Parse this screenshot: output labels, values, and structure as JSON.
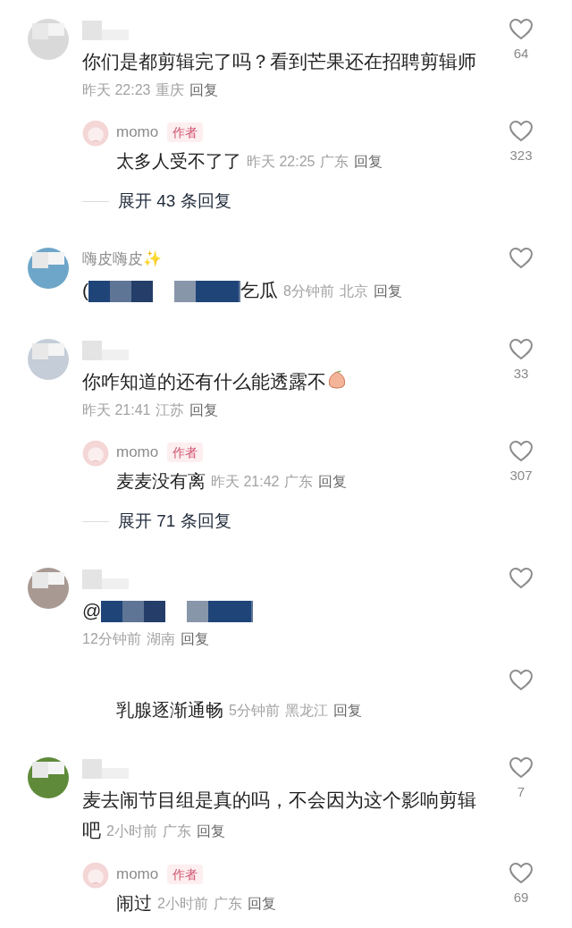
{
  "comments": [
    {
      "author": {
        "hidden": true
      },
      "avatar": {
        "kind": "user",
        "color": "#d9d9d9"
      },
      "content": [
        {
          "kind": "text",
          "text": "你们是都剪辑完了吗？看到芒果还在招聘剪辑师"
        }
      ],
      "meta_on_own_line": true,
      "time": "昨天 22:23",
      "location": "重庆",
      "reply_label": "回复",
      "likes": "64",
      "replies": [
        {
          "author": {
            "name": "momo",
            "badge": "作者"
          },
          "avatar": {
            "kind": "author",
            "color": "#f4d6d6"
          },
          "content": [
            {
              "kind": "text",
              "text": "太多人受不了了"
            }
          ],
          "time": "昨天 22:25",
          "location": "广东",
          "reply_label": "回复",
          "likes": "323"
        }
      ],
      "expand": "展开 43 条回复"
    },
    {
      "author": {
        "name": "嗨皮嗨皮✨"
      },
      "avatar": {
        "kind": "user",
        "color": "#6ea6c9"
      },
      "content": [
        {
          "kind": "text",
          "text": "("
        },
        {
          "kind": "redacted"
        },
        {
          "kind": "text",
          "text": "乞瓜"
        }
      ],
      "meta_on_own_line": false,
      "time": "8分钟前",
      "location": "北京",
      "reply_label": "回复"
    },
    {
      "author": {
        "hidden": true
      },
      "avatar": {
        "kind": "user",
        "color": "#c4cdd8"
      },
      "content": [
        {
          "kind": "text",
          "text": "你咋知道的还有什么能透露不"
        },
        {
          "kind": "emoji"
        }
      ],
      "meta_on_own_line": true,
      "time": "昨天 21:41",
      "location": "江苏",
      "reply_label": "回复",
      "likes": "33",
      "replies": [
        {
          "author": {
            "name": "momo",
            "badge": "作者"
          },
          "avatar": {
            "kind": "author",
            "color": "#f4d6d6"
          },
          "content": [
            {
              "kind": "text",
              "text": "麦麦没有离"
            }
          ],
          "time": "昨天 21:42",
          "location": "广东",
          "reply_label": "回复",
          "likes": "307"
        }
      ],
      "expand": "展开 71 条回复"
    },
    {
      "author": {
        "hidden": true
      },
      "avatar": {
        "kind": "user",
        "color": "#a89a92"
      },
      "content": [
        {
          "kind": "text",
          "text": "@"
        },
        {
          "kind": "redacted"
        }
      ],
      "meta_on_own_line": true,
      "time": "12分钟前",
      "location": "湖南",
      "reply_label": "回复",
      "replies": [
        {
          "content": [
            {
              "kind": "text",
              "text": "乳腺逐渐通畅"
            }
          ],
          "time": "5分钟前",
          "location": "黑龙江",
          "reply_label": "回复"
        }
      ]
    },
    {
      "author": {
        "hidden": true
      },
      "avatar": {
        "kind": "user",
        "color": "#5f8a3a"
      },
      "content": [
        {
          "kind": "text",
          "text": "麦去闹节目组是真的吗，不会因为这个影响剪辑吧"
        }
      ],
      "meta_on_own_line": false,
      "time": "2小时前",
      "location": "广东",
      "reply_label": "回复",
      "likes": "7",
      "replies": [
        {
          "author": {
            "name": "momo",
            "badge": "作者"
          },
          "avatar": {
            "kind": "author",
            "color": "#f4d6d6"
          },
          "content": [
            {
              "kind": "text",
              "text": "闹过"
            }
          ],
          "time": "2小时前",
          "location": "广东",
          "reply_label": "回复",
          "likes": "69"
        }
      ]
    }
  ]
}
